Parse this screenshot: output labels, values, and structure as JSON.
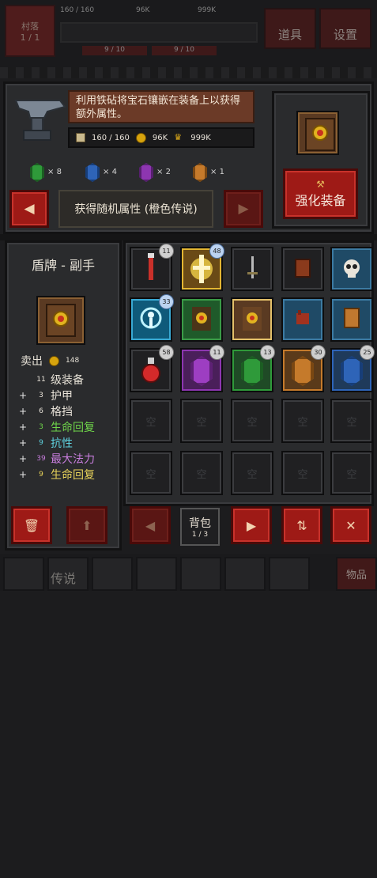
{
  "top_bar": {
    "village_label": "村落",
    "village_level": "1 / 1",
    "res_a": "160 / 160",
    "res_b": "96K",
    "res_c": "999K",
    "sub_a": "9 / 10",
    "sub_b": "9 / 10",
    "tools_label": "道具",
    "settings_label": "设置"
  },
  "forge": {
    "description": "利用铁砧将宝石镶嵌在装备上以获得额外属性。",
    "stones": "160 / 160",
    "gold": "96K",
    "crowns": "999K",
    "gems": [
      {
        "color": "green",
        "count": "8"
      },
      {
        "color": "blue",
        "count": "4"
      },
      {
        "color": "purple",
        "count": "2"
      },
      {
        "color": "orange",
        "count": "1"
      }
    ],
    "attribute_label": "获得随机属性 (橙色传说)",
    "enhance_label": "强化装备"
  },
  "detail": {
    "title": "盾牌 - 副手",
    "rarity": "传说",
    "sell_label": "卖出",
    "sell_price": "148",
    "level_num": "11",
    "level_label": "级装备",
    "stats": [
      {
        "sign": "+",
        "num": "3",
        "label": "护甲",
        "color": "#e8e2d8"
      },
      {
        "sign": "+",
        "num": "6",
        "label": "格挡",
        "color": "#e8e2d8"
      },
      {
        "sign": "+",
        "num": "3",
        "label": "生命回复",
        "color": "#6fd54a"
      },
      {
        "sign": "+",
        "num": "9",
        "label": "抗性",
        "color": "#5fd3e0"
      },
      {
        "sign": "+",
        "num": "39",
        "label": "最大法力",
        "color": "#c77ddc"
      },
      {
        "sign": "+",
        "num": "9",
        "label": "生命回复",
        "color": "#e8d35a"
      }
    ]
  },
  "inventory": {
    "badges": [
      "11",
      "48",
      "33",
      "58",
      "11",
      "13",
      "30",
      "25"
    ],
    "empty_label": "空",
    "bag_label": "背包",
    "bag_page": "1 / 3"
  },
  "footer": {
    "items_label": "物品"
  }
}
